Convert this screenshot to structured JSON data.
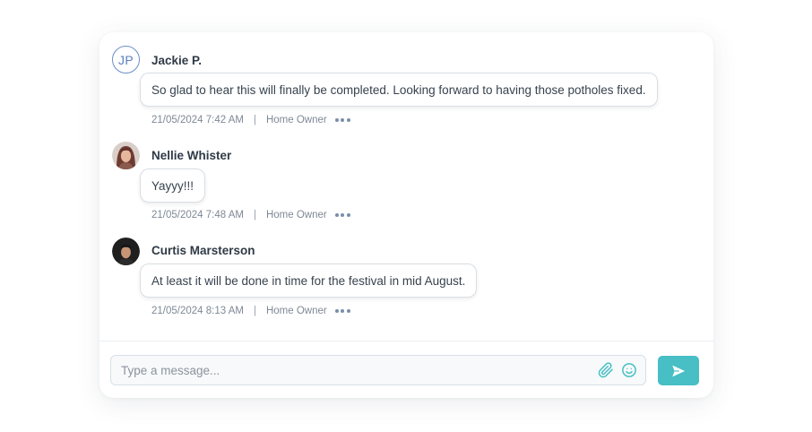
{
  "messages": [
    {
      "author": "Jackie P.",
      "initials": "JP",
      "avatar": "initials",
      "text": "So glad to hear this will finally be completed. Looking forward to having those potholes fixed.",
      "timestamp": "21/05/2024 7:42 AM",
      "separator": "|",
      "role": "Home Owner"
    },
    {
      "author": "Nellie Whister",
      "avatar": "photo",
      "text": "Yayyy!!!",
      "timestamp": "21/05/2024 7:48 AM",
      "separator": "|",
      "role": "Home Owner"
    },
    {
      "author": "Curtis Marsterson",
      "avatar": "photo",
      "text": "At least it will be done in time for the festival in mid August.",
      "timestamp": "21/05/2024 8:13 AM",
      "separator": "|",
      "role": "Home Owner"
    }
  ],
  "composer": {
    "placeholder": "Type a message...",
    "value": "",
    "attach_icon": "paperclip-icon",
    "emoji_icon": "smiley-icon",
    "send_icon": "send-icon"
  },
  "colors": {
    "accent": "#47bfc4",
    "author_text": "#2f3a46",
    "meta_text": "#7e8996",
    "initials_avatar": "#5a7fbf"
  }
}
